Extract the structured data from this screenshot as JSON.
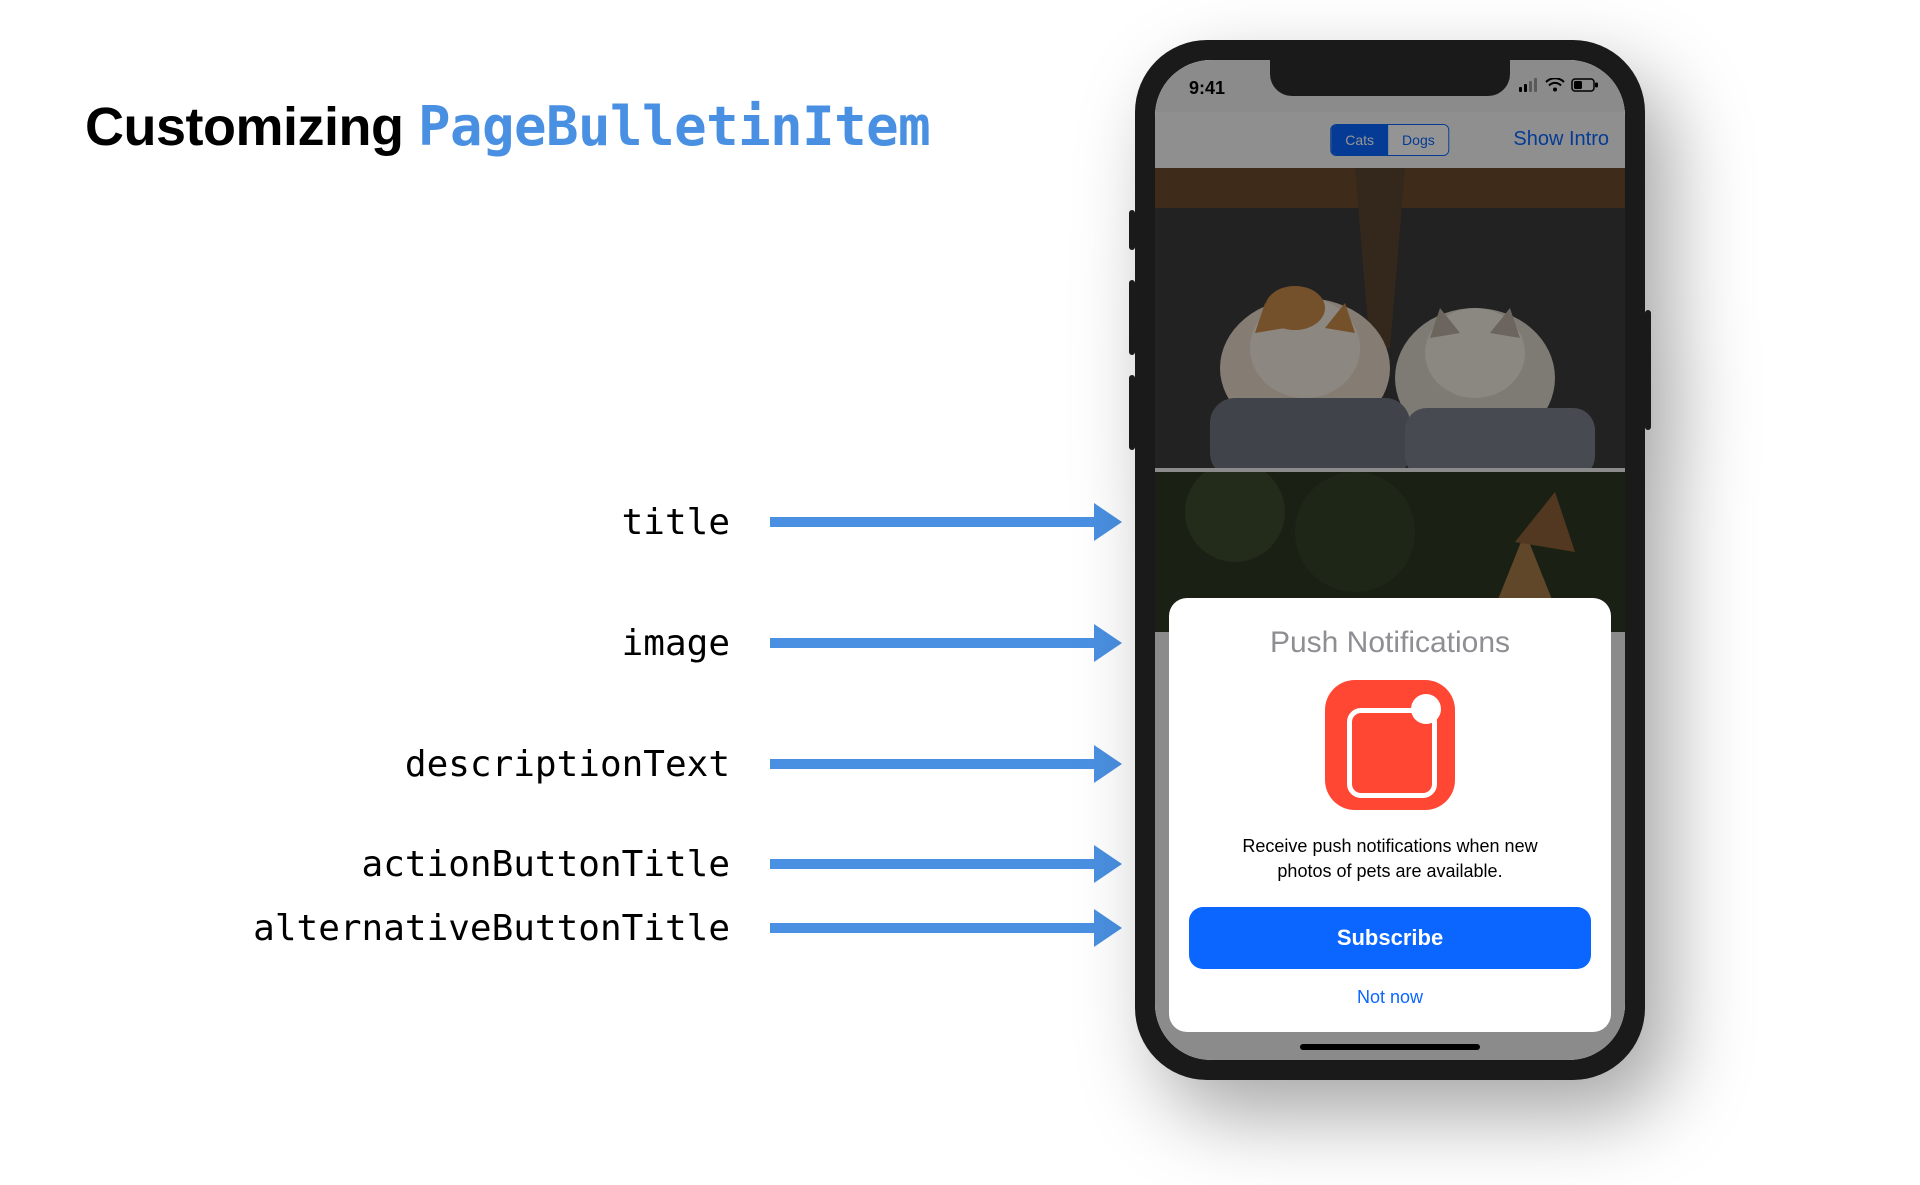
{
  "heading": {
    "prefix": "Customizing ",
    "code": "PageBulletinItem"
  },
  "labels": {
    "title": "title",
    "image": "image",
    "description": "descriptionText",
    "action": "actionButtonTitle",
    "alternative": "alternativeButtonTitle"
  },
  "statusbar": {
    "time": "9:41"
  },
  "app": {
    "segments": {
      "selected": "Cats",
      "other": "Dogs"
    },
    "nav_right": "Show Intro"
  },
  "bulletin": {
    "title": "Push Notifications",
    "description": "Receive push notifications when new photos of pets are available.",
    "action": "Subscribe",
    "alternative": "Not now"
  },
  "colors": {
    "accent": "#4a90e2",
    "ios_blue": "#0a66ff",
    "icon_red": "#ff4734"
  }
}
